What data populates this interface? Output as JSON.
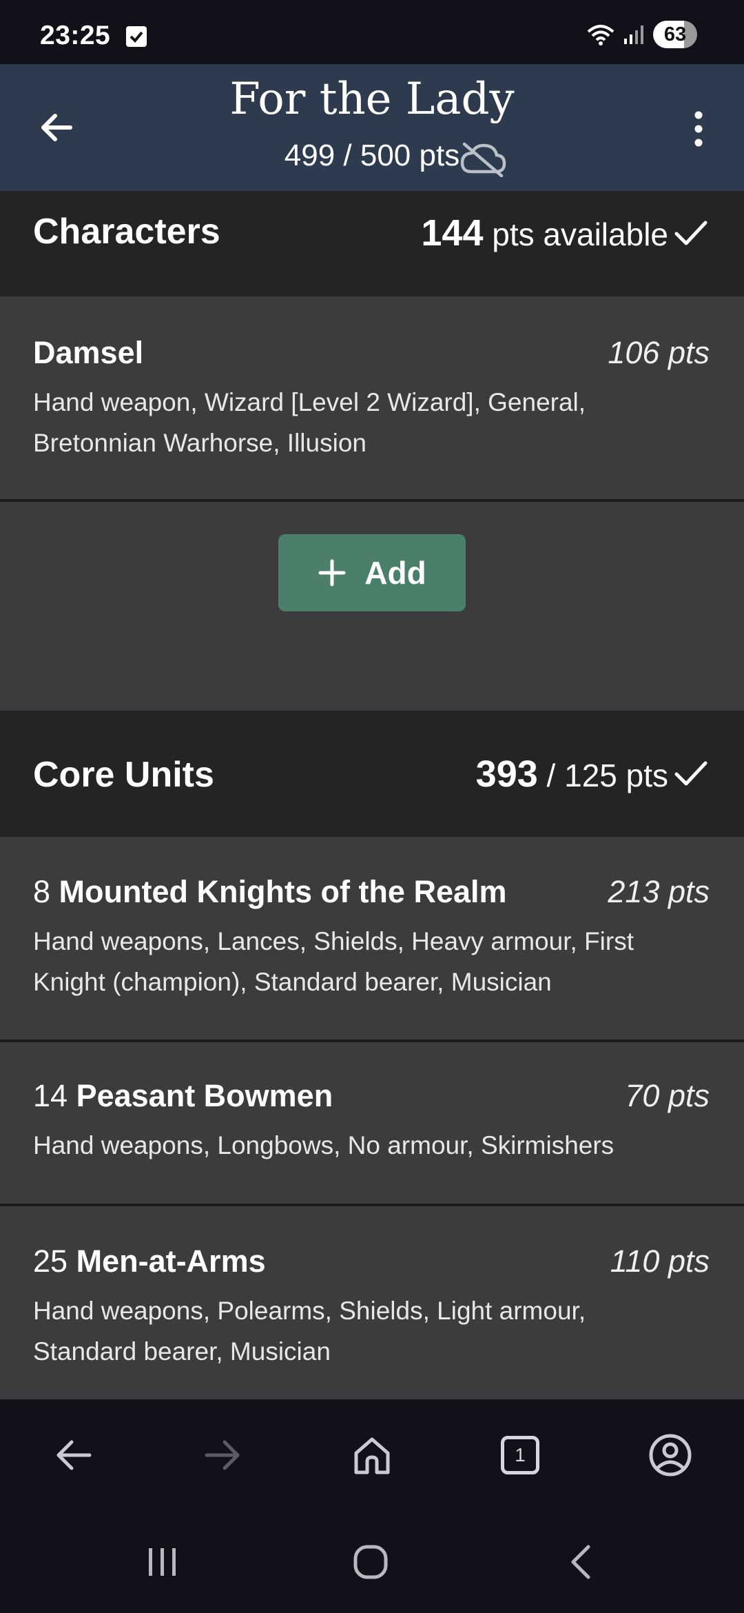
{
  "status_bar": {
    "time": "23:25",
    "battery": "63"
  },
  "header": {
    "title": "For the Lady",
    "points": "499 / 500 pts"
  },
  "sections": [
    {
      "title": "Characters",
      "points_value": "144",
      "points_suffix": "pts available",
      "units": [
        {
          "count": "",
          "name": "Damsel",
          "points": "106 pts",
          "desc": "Hand weapon, Wizard [Level 2 Wizard], General, Bretonnian Warhorse, Illusion"
        }
      ],
      "add_label": "Add"
    },
    {
      "title": "Core Units",
      "points_value": "393",
      "points_suffix": "/ 125 pts",
      "units": [
        {
          "count": "8",
          "name": "Mounted Knights of the Realm",
          "points": "213 pts",
          "desc": "Hand weapons, Lances, Shields, Heavy armour, First Knight (champion), Standard bearer, Musician"
        },
        {
          "count": "14",
          "name": "Peasant Bowmen",
          "points": "70 pts",
          "desc": "Hand weapons, Longbows, No armour, Skirmishers"
        },
        {
          "count": "25",
          "name": "Men-at-Arms",
          "points": "110 pts",
          "desc": "Hand weapons, Polearms, Shields, Light armour, Standard bearer, Musician"
        }
      ]
    }
  ],
  "browser_bar": {
    "tab_count": "1"
  },
  "icons": {
    "back": "arrow-left-icon",
    "menu": "more-vertical-icon",
    "sync": "cloud-off-icon",
    "check": "check-icon",
    "add": "plus-icon",
    "home": "home-icon",
    "profile": "account-circle-icon"
  },
  "colors": {
    "header_bg": "#2e3b4e",
    "section_bg": "#242424",
    "card_bg": "#3c3c3e",
    "accent": "#4a8069",
    "system_bg": "#111219"
  }
}
